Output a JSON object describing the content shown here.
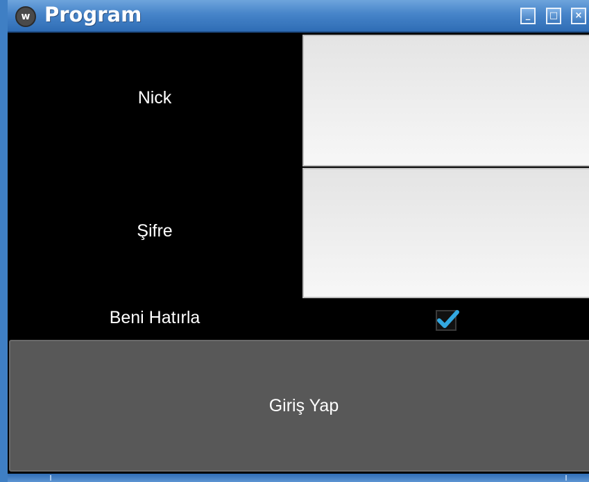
{
  "window": {
    "title": "Program",
    "app_icon_glyph": "w",
    "controls": {
      "minimize": "_",
      "maximize": "□",
      "close": "×"
    }
  },
  "form": {
    "nick_label": "Nick",
    "nick_value": "",
    "password_label": "Şifre",
    "password_value": "",
    "remember_label": "Beni Hatırla",
    "remember_checked": true,
    "login_button": "Giriş Yap"
  },
  "colors": {
    "titlebar": "#4684c9",
    "checkmark": "#33a8e0",
    "button": "#585858",
    "background": "#000000"
  }
}
